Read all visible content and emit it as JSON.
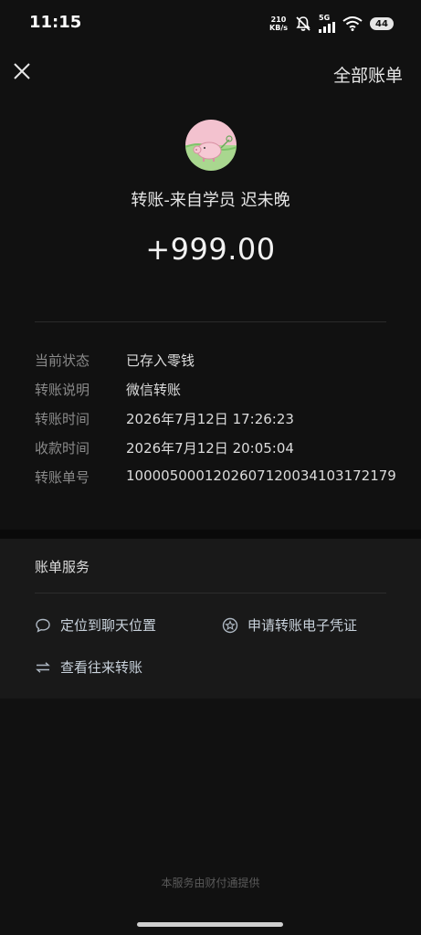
{
  "status_bar": {
    "time": "11:15",
    "net_speed_value": "210",
    "net_speed_unit": "KB/s",
    "network": "5G",
    "battery": "44",
    "icons": [
      "mute-bell-icon",
      "signal-icon",
      "wifi-icon",
      "battery-icon"
    ]
  },
  "header": {
    "close_icon": "close-icon",
    "all_bills": "全部账单"
  },
  "payer": {
    "title": "转账-来自学员 迟未晚",
    "amount": "+999.00",
    "avatar_colors": [
      "#f2b8c6",
      "#a8d890"
    ]
  },
  "details": [
    {
      "label": "当前状态",
      "value": "已存入零钱"
    },
    {
      "label": "转账说明",
      "value": "微信转账"
    },
    {
      "label": "转账时间",
      "value": "2026年7月12日 17:26:23"
    },
    {
      "label": "收款时间",
      "value": "2026年7月12日 20:05:04"
    },
    {
      "label": "转账单号",
      "value": "1000050001202607120034103172179"
    }
  ],
  "services": {
    "title": "账单服务",
    "locate_chat": "定位到聊天位置",
    "apply_voucher": "申请转账电子凭证",
    "view_transfers": "查看往来转账"
  },
  "footer": "本服务由财付通提供",
  "colors": {
    "background": "#111111",
    "card": "#191919",
    "link": "#c9d2dc",
    "muted": "#8a8a8a"
  }
}
